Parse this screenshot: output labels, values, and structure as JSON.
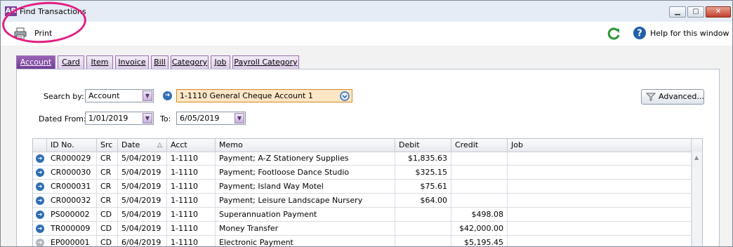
{
  "window": {
    "app_icon": "AR",
    "title": "Find Transactions",
    "controls": {
      "minimize": "▁",
      "maximize": "▢",
      "close": "✕"
    }
  },
  "toolbar": {
    "print_label": "Print",
    "print_icon": "printer-icon",
    "refresh_icon": "refresh-icon",
    "help_icon": "help-icon",
    "help_label": "Help for this window",
    "highlight_color": "#e01f83"
  },
  "tabs": [
    {
      "label": "Account",
      "active": true
    },
    {
      "label": "Card",
      "active": false
    },
    {
      "label": "Item",
      "active": false
    },
    {
      "label": "Invoice",
      "active": false
    },
    {
      "label": "Bill",
      "active": false
    },
    {
      "label": "Category",
      "active": false
    },
    {
      "label": "Job",
      "active": false
    },
    {
      "label": "Payroll Category",
      "active": false
    }
  ],
  "filters": {
    "search_by_label": "Search by:",
    "search_by_value": "Account",
    "account_value": "1-1110 General Cheque Account 1",
    "dated_from_label": "Dated From:",
    "dated_from_value": "1/01/2019",
    "to_label": "To:",
    "to_value": "6/05/2019",
    "advanced_label": "Advanced..."
  },
  "table": {
    "columns": [
      "ID No.",
      "Src",
      "Date",
      "Acct",
      "Memo",
      "Debit",
      "Credit",
      "Job"
    ],
    "sort_indicator": "△",
    "rows": [
      {
        "id": "CR000029",
        "src": "CR",
        "date": "5/04/2019",
        "acct": "1-1110",
        "memo": "Payment; A-Z Stationery Supplies",
        "debit": "$1,835.63",
        "credit": "",
        "job": ""
      },
      {
        "id": "CR000030",
        "src": "CR",
        "date": "5/04/2019",
        "acct": "1-1110",
        "memo": "Payment; Footloose Dance Studio",
        "debit": "$325.15",
        "credit": "",
        "job": ""
      },
      {
        "id": "CR000031",
        "src": "CR",
        "date": "5/04/2019",
        "acct": "1-1110",
        "memo": "Payment; Island Way Motel",
        "debit": "$75.61",
        "credit": "",
        "job": ""
      },
      {
        "id": "CR000032",
        "src": "CR",
        "date": "5/04/2019",
        "acct": "1-1110",
        "memo": "Payment; Leisure Landscape Nursery",
        "debit": "$64.00",
        "credit": "",
        "job": ""
      },
      {
        "id": "PS000002",
        "src": "CD",
        "date": "5/04/2019",
        "acct": "1-1110",
        "memo": "Superannuation Payment",
        "debit": "",
        "credit": "$498.08",
        "job": ""
      },
      {
        "id": "TR000009",
        "src": "CD",
        "date": "5/04/2019",
        "acct": "1-1110",
        "memo": "Money Transfer",
        "debit": "",
        "credit": "$42,000.00",
        "job": ""
      },
      {
        "id": "EP000001",
        "src": "CD",
        "date": "6/04/2019",
        "acct": "1-1110",
        "memo": "Electronic Payment",
        "debit": "",
        "credit": "$5,195.45",
        "job": ""
      }
    ]
  },
  "colors": {
    "tab_active": "#6d3a92",
    "link_arrow": "#2f6db3",
    "account_field_bg": "#fbe6c6"
  }
}
